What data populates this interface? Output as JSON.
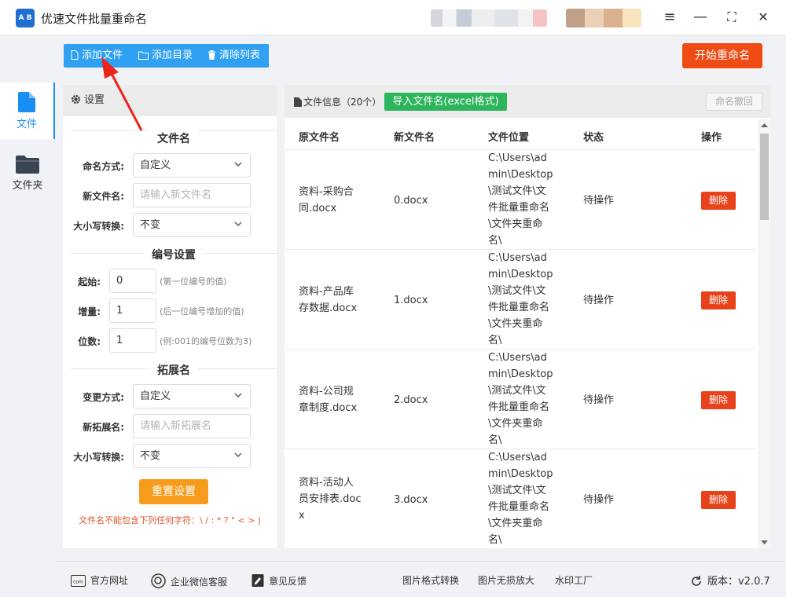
{
  "app": {
    "logo_text": "A B",
    "title": "优速文件批量重命名"
  },
  "window_controls": {
    "menu": "≡",
    "minimize": "—",
    "maximize": "⛶",
    "close": "✕"
  },
  "nav": [
    {
      "label": "文件",
      "icon": "file-icon",
      "active": true
    },
    {
      "label": "文件夹",
      "icon": "folder-icon",
      "active": false
    }
  ],
  "toolbar": {
    "add_file": "添加文件",
    "add_dir": "添加目录",
    "clear_list": "清除列表",
    "start": "开始重命名"
  },
  "settings": {
    "header": "设置",
    "filename_section": "文件名",
    "naming_mode_label": "命名方式:",
    "naming_mode_value": "自定义",
    "new_name_label": "新文件名:",
    "new_name_placeholder": "请输入新文件名",
    "case_label": "大小写转换:",
    "case_value": "不变",
    "numbering_section": "编号设置",
    "start_label": "起始:",
    "start_value": "0",
    "start_hint": "(第一位编号的值)",
    "step_label": "增量:",
    "step_value": "1",
    "step_hint": "(后一位编号增加的值)",
    "digits_label": "位数:",
    "digits_value": "1",
    "digits_hint": "(例:001的编号位数为3)",
    "ext_section": "拓展名",
    "ext_mode_label": "变更方式:",
    "ext_mode_value": "自定义",
    "new_ext_label": "新拓展名:",
    "new_ext_placeholder": "请输入新拓展名",
    "ext_case_label": "大小写转换:",
    "ext_case_value": "不变",
    "reset": "重置设置",
    "warning": "文件名不能包含下列任何字符：\\ / : * ? \" < > |"
  },
  "files": {
    "title": "文件信息（20个）",
    "import": "导入文件名(excel格式)",
    "undo": "命名撤回",
    "columns": [
      "原文件名",
      "新文件名",
      "文件位置",
      "状态",
      "操作"
    ],
    "rows": [
      {
        "orig": [
          "资料-采购合",
          "同.docx"
        ],
        "new": "0.docx",
        "path": [
          "C:\\Users\\ad",
          "min\\Desktop",
          "\\测试文件\\文",
          "件批量重命名",
          "\\文件夹重命",
          "名\\"
        ],
        "status": "待操作",
        "action": "删除"
      },
      {
        "orig": [
          "资料-产品库",
          "存数据.docx"
        ],
        "new": "1.docx",
        "path": [
          "C:\\Users\\ad",
          "min\\Desktop",
          "\\测试文件\\文",
          "件批量重命名",
          "\\文件夹重命",
          "名\\"
        ],
        "status": "待操作",
        "action": "删除"
      },
      {
        "orig": [
          "资料-公司规",
          "章制度.docx"
        ],
        "new": "2.docx",
        "path": [
          "C:\\Users\\ad",
          "min\\Desktop",
          "\\测试文件\\文",
          "件批量重命名",
          "\\文件夹重命",
          "名\\"
        ],
        "status": "待操作",
        "action": "删除"
      },
      {
        "orig": [
          "资料-活动人",
          "员安排表.doc",
          "x"
        ],
        "new": "3.docx",
        "path": [
          "C:\\Users\\ad",
          "min\\Desktop",
          "\\测试文件\\文",
          "件批量重命名",
          "\\文件夹重命",
          "名\\"
        ],
        "status": "待操作",
        "action": "删除"
      }
    ]
  },
  "footer": {
    "website": "官方网址",
    "wechat": "企业微信客服",
    "feedback": "意见反馈",
    "img_convert": "图片格式转换",
    "img_enlarge": "图片无损放大",
    "watermark": "水印工厂",
    "version": "版本：v2.0.7",
    "website_icon_text": "com"
  },
  "colors": {
    "accent": "#2fa0f2",
    "start": "#ef4b14",
    "import": "#2db55d",
    "delete": "#e8421a",
    "reset": "#f79b1c"
  }
}
